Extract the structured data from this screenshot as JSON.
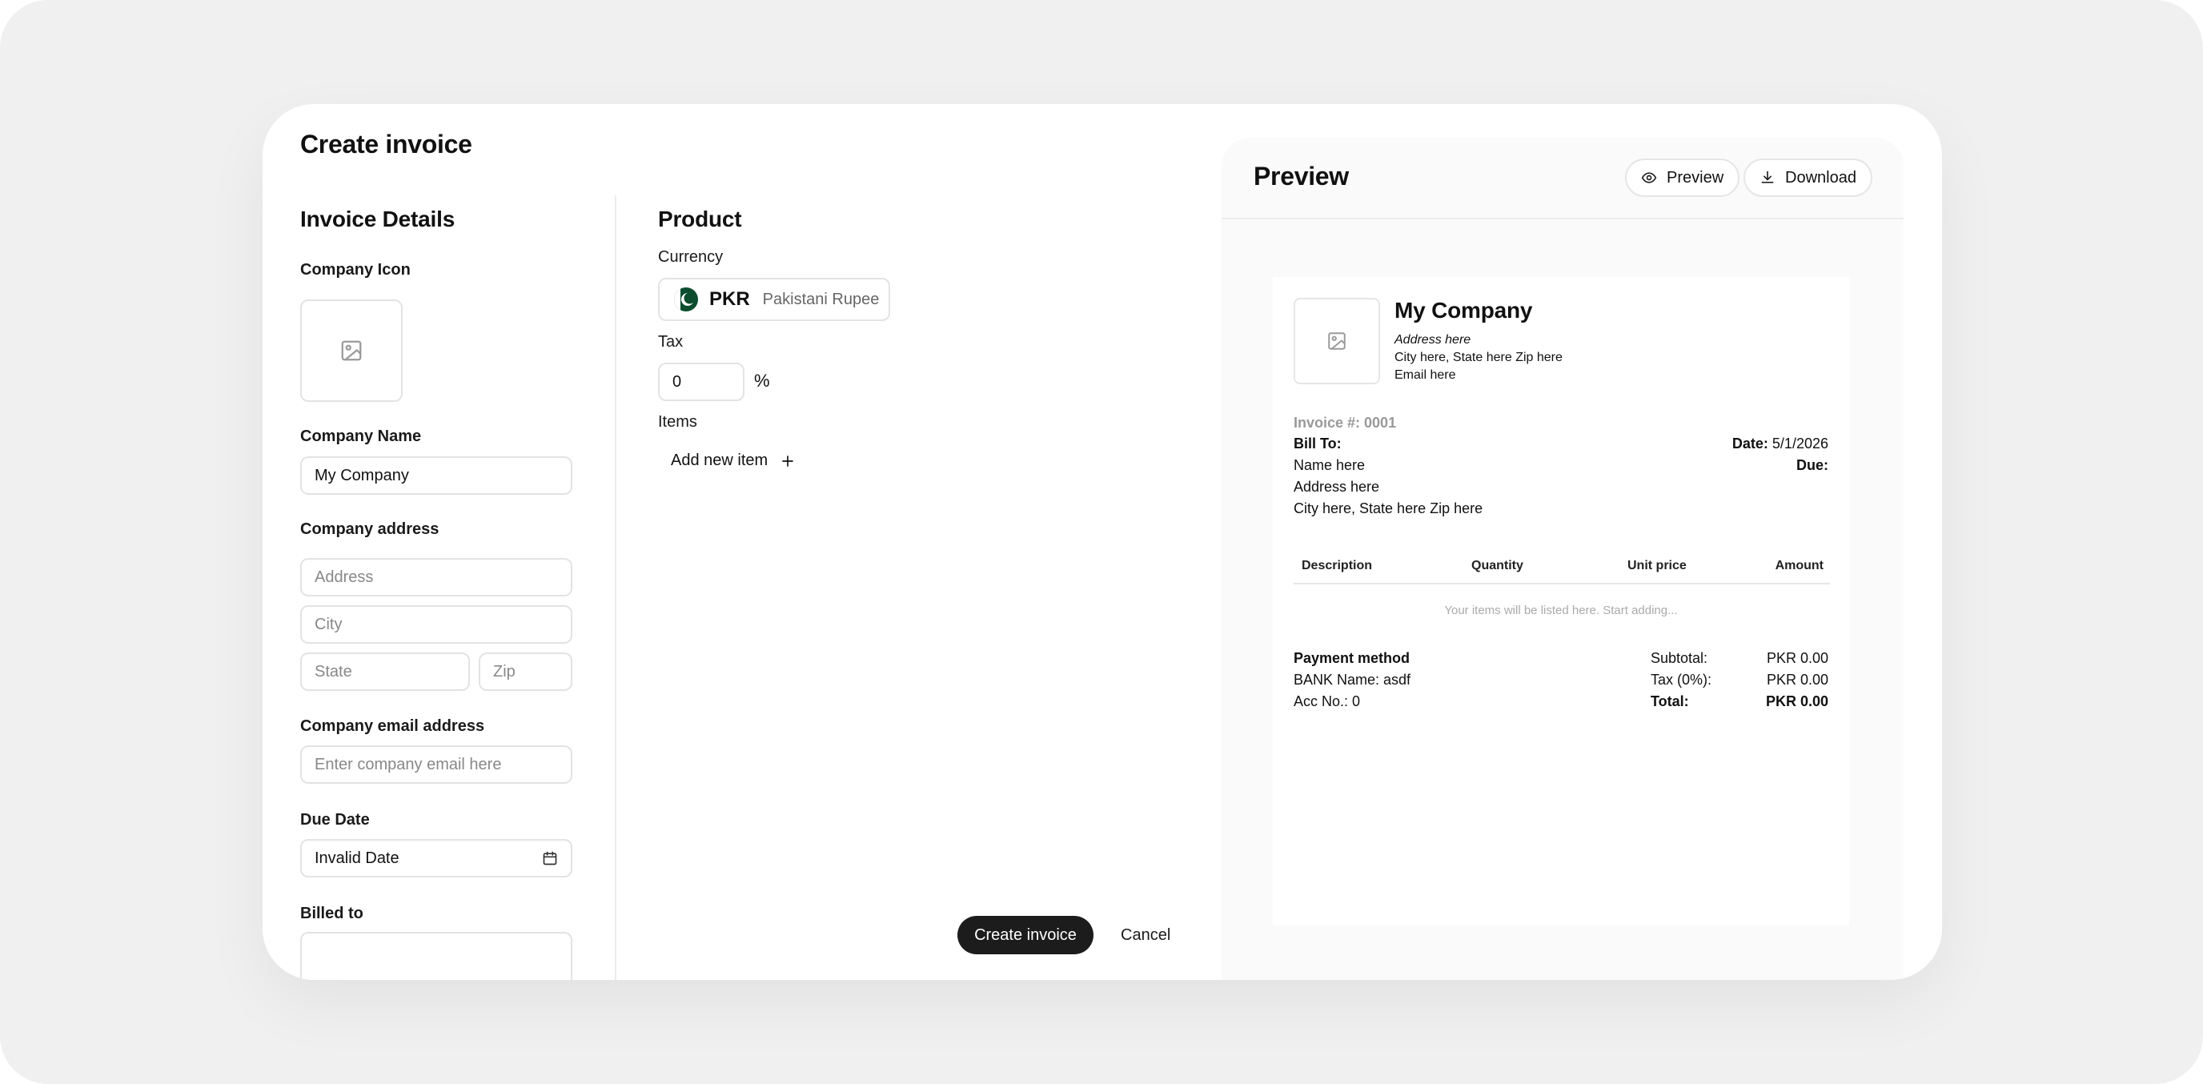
{
  "modal": {
    "title": "Create invoice"
  },
  "details": {
    "title": "Invoice Details",
    "company_icon_label": "Company Icon",
    "company_name_label": "Company Name",
    "company_name_value": "My Company",
    "company_address_label": "Company address",
    "address_placeholder": "Address",
    "city_placeholder": "City",
    "state_placeholder": "State",
    "zip_placeholder": "Zip",
    "email_label": "Company email address",
    "email_placeholder": "Enter company email here",
    "due_date_label": "Due Date",
    "due_date_value": "Invalid Date",
    "billed_to_label": "Billed to"
  },
  "product": {
    "title": "Product",
    "currency_label": "Currency",
    "currency_code": "PKR",
    "currency_name": "Pakistani Rupee",
    "tax_label": "Tax",
    "tax_value": "0",
    "tax_unit": "%",
    "items_label": "Items",
    "add_item_label": "Add new item"
  },
  "actions": {
    "create": "Create invoice",
    "cancel": "Cancel"
  },
  "preview": {
    "title": "Preview",
    "preview_button": "Preview",
    "download_button": "Download",
    "company_name": "My Company",
    "address": "Address here",
    "city_line": "City here, State here Zip here",
    "email": "Email here",
    "invoice_number": "Invoice #: 0001",
    "bill_to_label": "Bill To:",
    "bill_name": "Name here",
    "bill_address": "Address here",
    "bill_city_line": "City here, State here Zip here",
    "date_label": "Date:",
    "date_value": "5/1/2026",
    "due_label": "Due:",
    "columns": [
      "Description",
      "Quantity",
      "Unit price",
      "Amount"
    ],
    "empty_message": "Your items will be listed here. Start adding...",
    "payment_method_label": "Payment method",
    "bank_line": "BANK Name: asdf",
    "acc_line": "Acc No.: 0",
    "subtotal_label": "Subtotal:",
    "subtotal_value": "PKR 0.00",
    "tax_label": "Tax (0%):",
    "tax_value": "PKR 0.00",
    "total_label": "Total:",
    "total_value": "PKR 0.00"
  }
}
